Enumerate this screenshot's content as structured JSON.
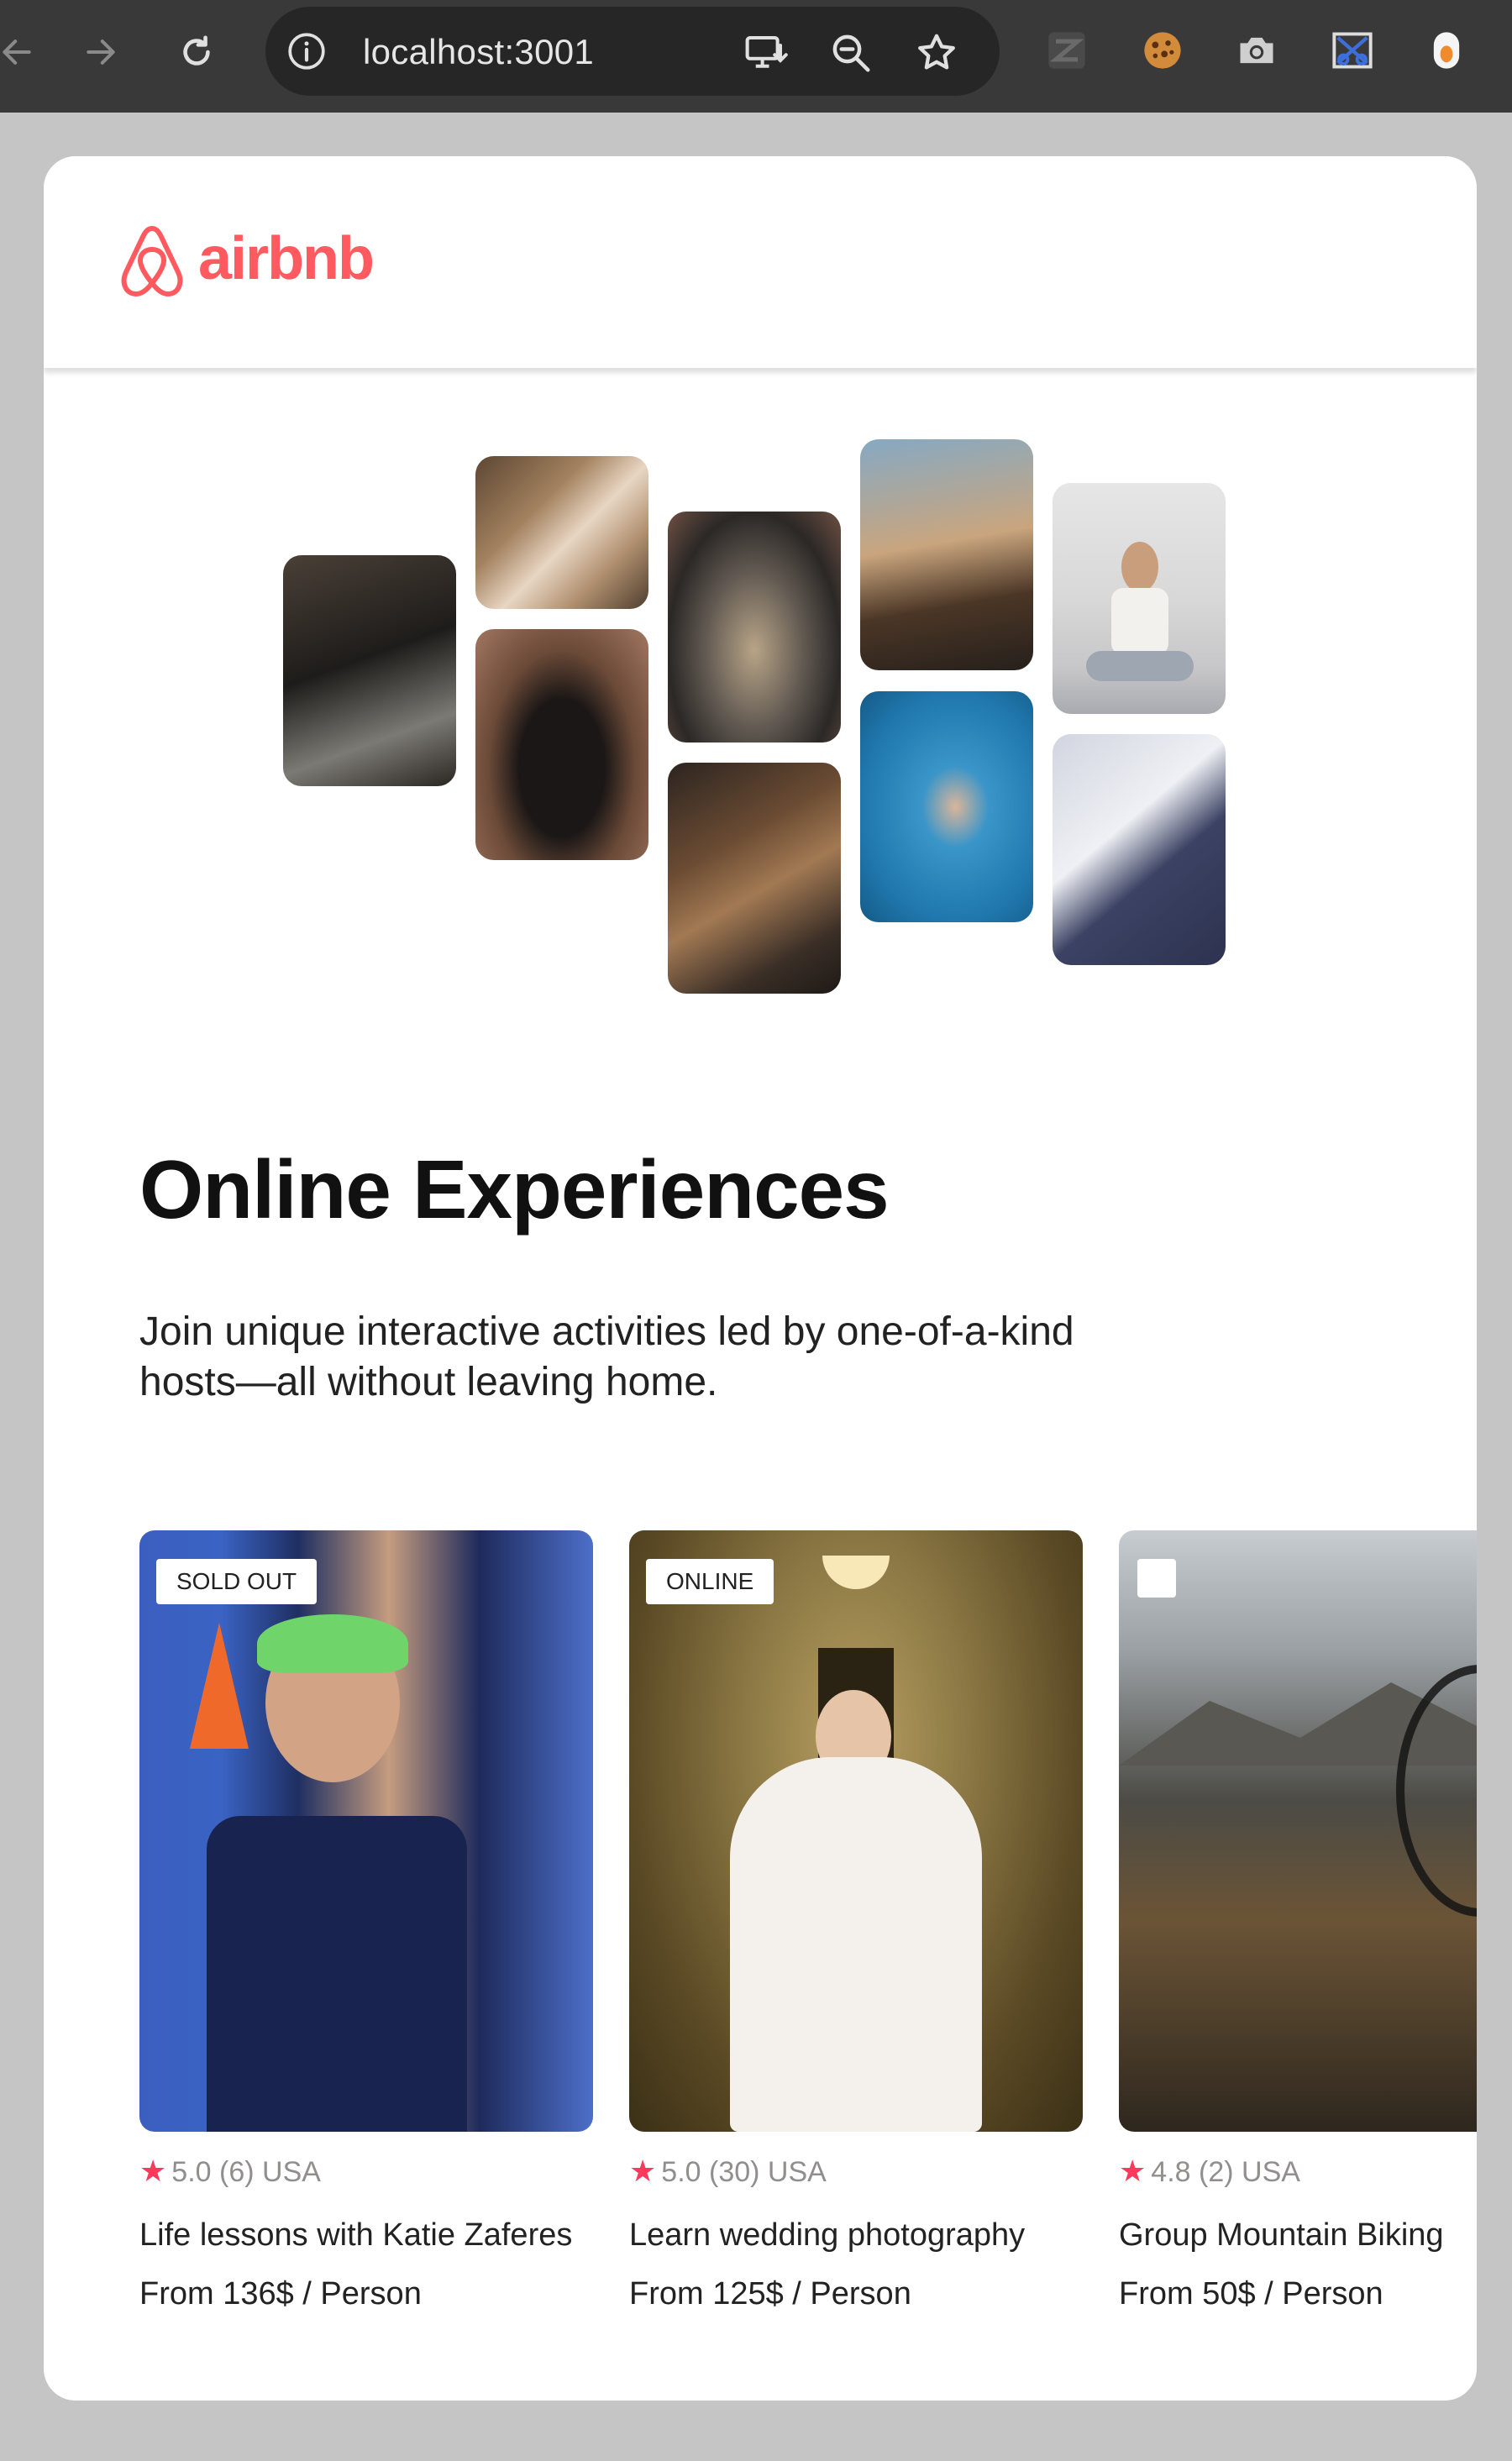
{
  "browser": {
    "url": "localhost:3001"
  },
  "navbar": {
    "logo_text": "airbnb"
  },
  "hero": {
    "title": "Online Experiences",
    "description": "Join unique interactive activities led by one-of-a-kind hosts—all without leaving home."
  },
  "experiences": [
    {
      "badge": "SOLD OUT",
      "rating": "5.0",
      "reviews": "(6)",
      "location": "USA",
      "title": "Life lessons with Katie Zaferes",
      "price": "From 136$ / Person"
    },
    {
      "badge": "ONLINE",
      "rating": "5.0",
      "reviews": "(30)",
      "location": "USA",
      "title": "Learn wedding photography",
      "price": "From 125$ / Person"
    },
    {
      "badge": "",
      "rating": "4.8",
      "reviews": "(2)",
      "location": "USA",
      "title": "Group Mountain Biking",
      "price": "From 50$ / Person"
    }
  ],
  "colors": {
    "brand": "#ff5a5f",
    "star": "#fe395c",
    "page_background": "#c5c5c5",
    "chrome_background": "#393939"
  }
}
